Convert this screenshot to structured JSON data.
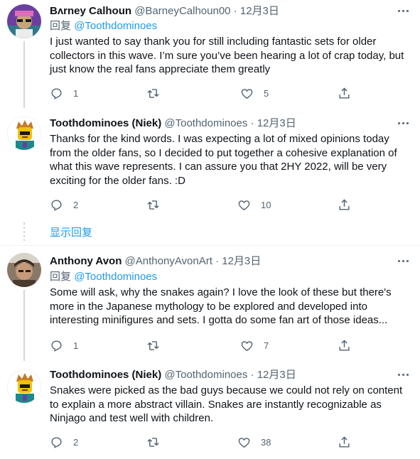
{
  "tweets": [
    {
      "name": "Bʌrney Calhoun",
      "handle": "@BarneyCalhoun00",
      "dot": "·",
      "date": "12月3日",
      "reply_prefix": "回复",
      "reply_to": "@Toothdominoes",
      "lines": [
        "I just wanted to say thank you for still including fantastic sets for older",
        "collectors in this wave. I’m sure you’ve been hearing a lot of crap today, but",
        "just know the real fans appreciate them greatly"
      ],
      "reply_count": "1",
      "retweet_count": "",
      "like_count": "5"
    },
    {
      "name": "Toothdominoes (Niek)",
      "handle": "@Toothdominoes",
      "dot": "·",
      "date": "12月3日",
      "lines": [
        "Thanks for the kind words. I was expecting a lot of mixed opinions today",
        "from the older fans, so I decided to put together a cohesive explanation of",
        "what this wave represents. I can assure you that 2HY 2022, will be very",
        "exciting for the older fans. :D"
      ],
      "reply_count": "2",
      "retweet_count": "",
      "like_count": "10"
    },
    {
      "name": "Anthony Avon",
      "handle": "@AnthonyAvonArt",
      "dot": "·",
      "date": "12月3日",
      "reply_prefix": "回复",
      "reply_to": "@Toothdominoes",
      "lines": [
        "Some will ask, why the snakes again? I love the look of these but there's",
        "more in the Japanese mythology to be explored and developed into",
        "interesting minifigures and sets. I gotta do some fan art of those ideas..."
      ],
      "reply_count": "1",
      "retweet_count": "",
      "like_count": "7"
    },
    {
      "name": "Toothdominoes (Niek)",
      "handle": "@Toothdominoes",
      "dot": "·",
      "date": "12月3日",
      "lines": [
        "Snakes were picked as the bad guys because we could not rely on content",
        "to explain a more abstract villain. Snakes are instantly recognizable as",
        "Ninjago and test well with children."
      ],
      "reply_count": "2",
      "retweet_count": "",
      "like_count": "38"
    }
  ],
  "show_replies_label": "显示回复",
  "colors": {
    "accent": "#1d9bf0",
    "secondary_text": "#536471",
    "primary_text": "#0f1419",
    "divider": "#eff3f4"
  },
  "icons": [
    "more-icon",
    "reply-icon",
    "retweet-icon",
    "like-icon",
    "share-icon"
  ]
}
